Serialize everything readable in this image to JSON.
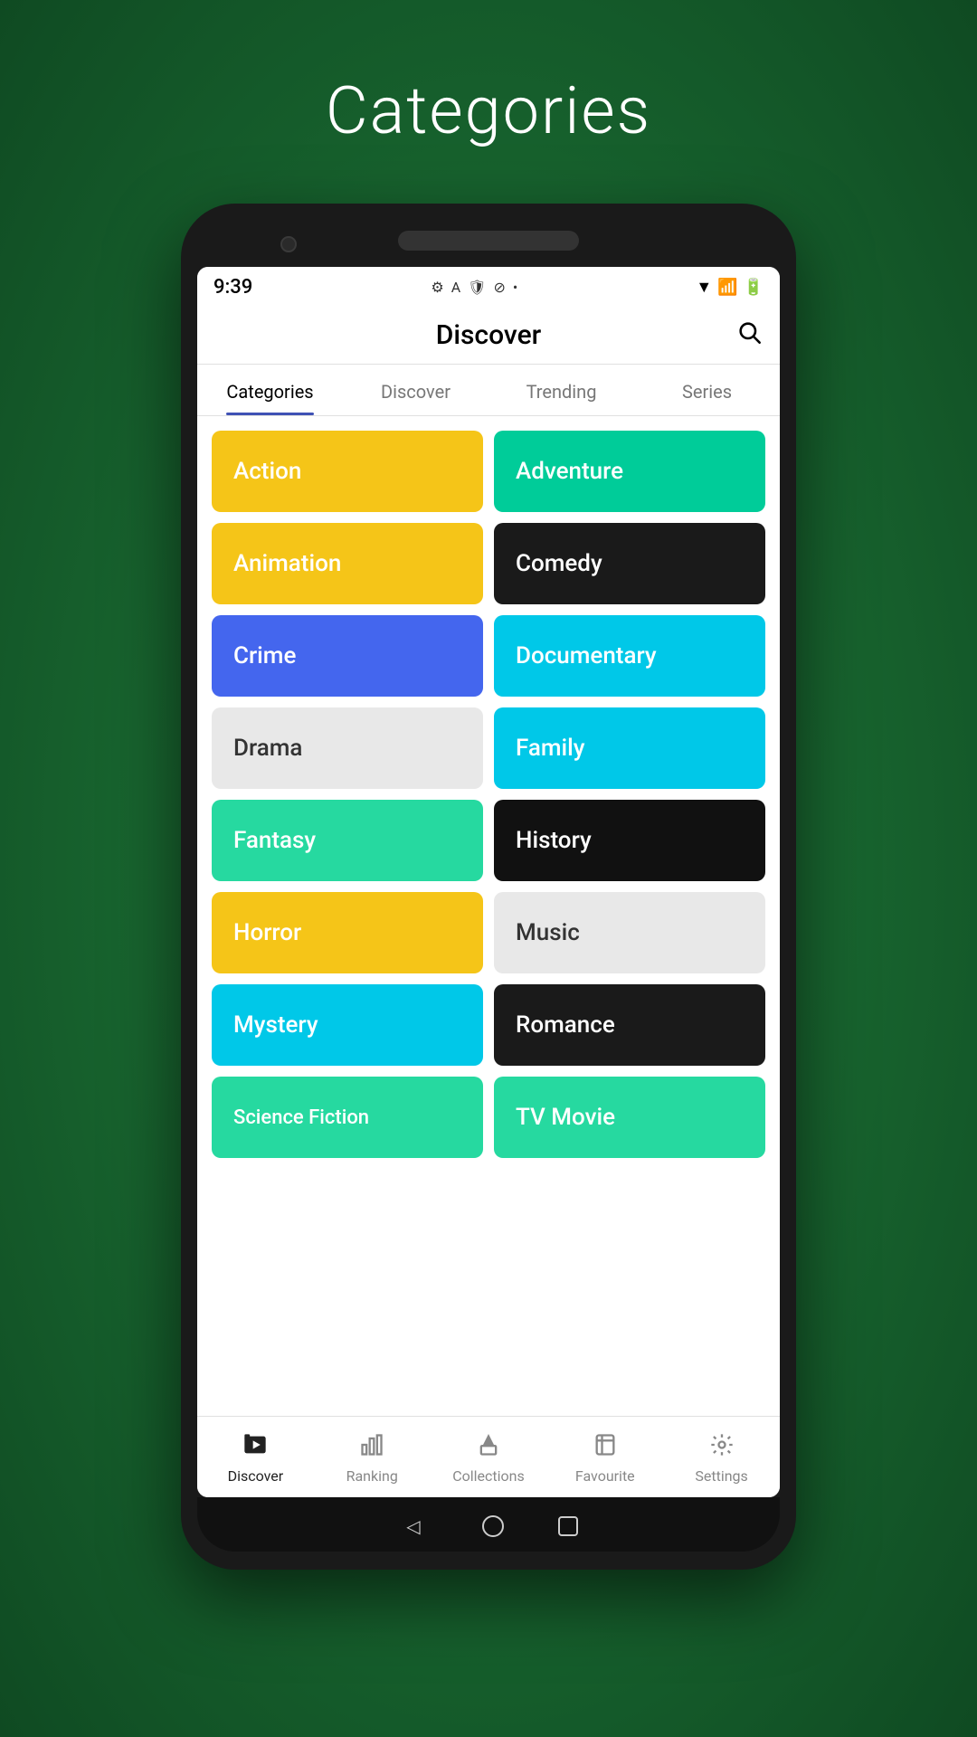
{
  "page": {
    "title": "Categories",
    "background_color": "#1e7a40"
  },
  "status_bar": {
    "time": "9:39",
    "icons": [
      "gear",
      "A",
      "shield",
      "circle-ban",
      "dot"
    ]
  },
  "app_bar": {
    "title": "Discover",
    "search_icon": "🔍"
  },
  "tabs": [
    {
      "id": "categories",
      "label": "Categories",
      "active": true
    },
    {
      "id": "discover",
      "label": "Discover",
      "active": false
    },
    {
      "id": "trending",
      "label": "Trending",
      "active": false
    },
    {
      "id": "series",
      "label": "Series",
      "active": false
    }
  ],
  "categories": [
    {
      "id": "action",
      "label": "Action",
      "bg_class": "bg-yellow",
      "text_light": false
    },
    {
      "id": "adventure",
      "label": "Adventure",
      "bg_class": "bg-green-teal",
      "text_light": false
    },
    {
      "id": "animation",
      "label": "Animation",
      "bg_class": "bg-yellow",
      "text_light": false
    },
    {
      "id": "comedy",
      "label": "Comedy",
      "bg_class": "bg-black",
      "text_light": false
    },
    {
      "id": "crime",
      "label": "Crime",
      "bg_class": "bg-blue",
      "text_light": false
    },
    {
      "id": "documentary",
      "label": "Documentary",
      "bg_class": "bg-cyan",
      "text_light": false
    },
    {
      "id": "drama",
      "label": "Drama",
      "bg_class": "bg-gray",
      "text_light": true
    },
    {
      "id": "family",
      "label": "Family",
      "bg_class": "bg-cyan",
      "text_light": false
    },
    {
      "id": "fantasy",
      "label": "Fantasy",
      "bg_class": "bg-teal-light",
      "text_light": false
    },
    {
      "id": "history",
      "label": "History",
      "bg_class": "bg-dark",
      "text_light": false
    },
    {
      "id": "horror",
      "label": "Horror",
      "bg_class": "bg-yellow",
      "text_light": false
    },
    {
      "id": "music",
      "label": "Music",
      "bg_class": "bg-gray",
      "text_light": true
    },
    {
      "id": "mystery",
      "label": "Mystery",
      "bg_class": "bg-mystery",
      "text_light": false
    },
    {
      "id": "romance",
      "label": "Romance",
      "bg_class": "bg-romance",
      "text_light": false
    },
    {
      "id": "science-fiction",
      "label": "Science Fiction",
      "bg_class": "bg-scifi",
      "text_light": false
    },
    {
      "id": "tv-movie",
      "label": "TV Movie",
      "bg_class": "bg-tvmovie",
      "text_light": false
    }
  ],
  "bottom_nav": [
    {
      "id": "discover",
      "label": "Discover",
      "icon": "🎬",
      "active": true
    },
    {
      "id": "ranking",
      "label": "Ranking",
      "icon": "📊",
      "active": false
    },
    {
      "id": "collections",
      "label": "Collections",
      "icon": "🎞️",
      "active": false
    },
    {
      "id": "favourite",
      "label": "Favourite",
      "icon": "📋",
      "active": false
    },
    {
      "id": "settings",
      "label": "Settings",
      "icon": "⚙️",
      "active": false
    }
  ]
}
